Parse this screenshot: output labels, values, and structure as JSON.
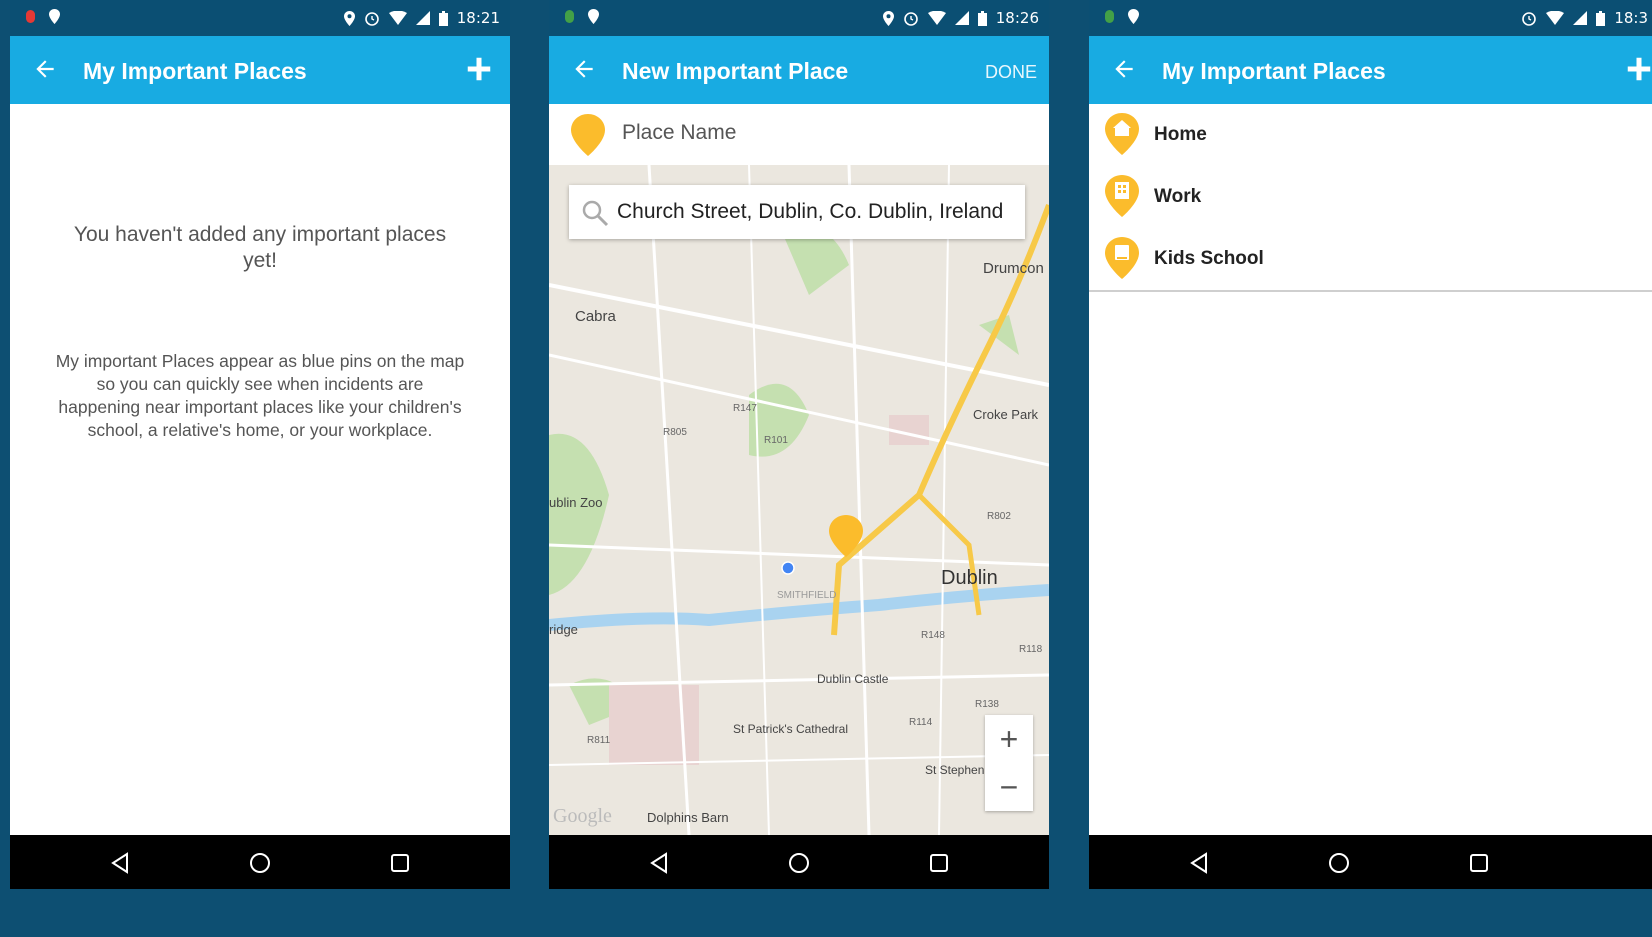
{
  "phone1": {
    "status": {
      "time": "18:21"
    },
    "appbar": {
      "title": "My Important Places"
    },
    "empty_title": "You haven't added any important places yet!",
    "empty_description": "My important Places appear as blue pins on the map so you can quickly see when incidents are happening near important places like your children's school, a relative's home, or your workplace."
  },
  "phone2": {
    "status": {
      "time": "18:26"
    },
    "appbar": {
      "title": "New Important Place",
      "done_label": "DONE"
    },
    "place_name": {
      "placeholder": "Place Name",
      "value": ""
    },
    "search": {
      "value": "Church Street, Dublin, Co. Dublin, Ireland"
    },
    "map": {
      "labels": {
        "cabra": "Cabra",
        "drumcondra": "Drumcon",
        "croke_park": "Croke Park",
        "zoo": "ublin Zoo",
        "dublin": "Dublin",
        "smithfield": "SMITHFIELD",
        "bridge": "ridge",
        "dublin_castle": "Dublin Castle",
        "st_patricks": "St Patrick's Cathedral",
        "st_stephen": "St Stephen",
        "dolphins_barn": "Dolphins Barn",
        "google": "Google",
        "r147": "R147",
        "r805": "R805",
        "r101": "R101",
        "r802": "R802",
        "r148": "R148",
        "r118": "R118",
        "r138": "R138",
        "r114": "R114",
        "r811": "R811"
      },
      "zoom_in": "+",
      "zoom_out": "−"
    }
  },
  "phone3": {
    "status": {
      "time": "18:3"
    },
    "appbar": {
      "title": "My Important Places"
    },
    "places": [
      {
        "label": "Home",
        "icon": "home-icon"
      },
      {
        "label": "Work",
        "icon": "building-icon"
      },
      {
        "label": "Kids School",
        "icon": "book-icon"
      }
    ]
  },
  "colors": {
    "appbar": "#18abe2",
    "statusbar": "#0b4f73",
    "pin": "#fbbc2c",
    "background": "#0d4f72"
  }
}
